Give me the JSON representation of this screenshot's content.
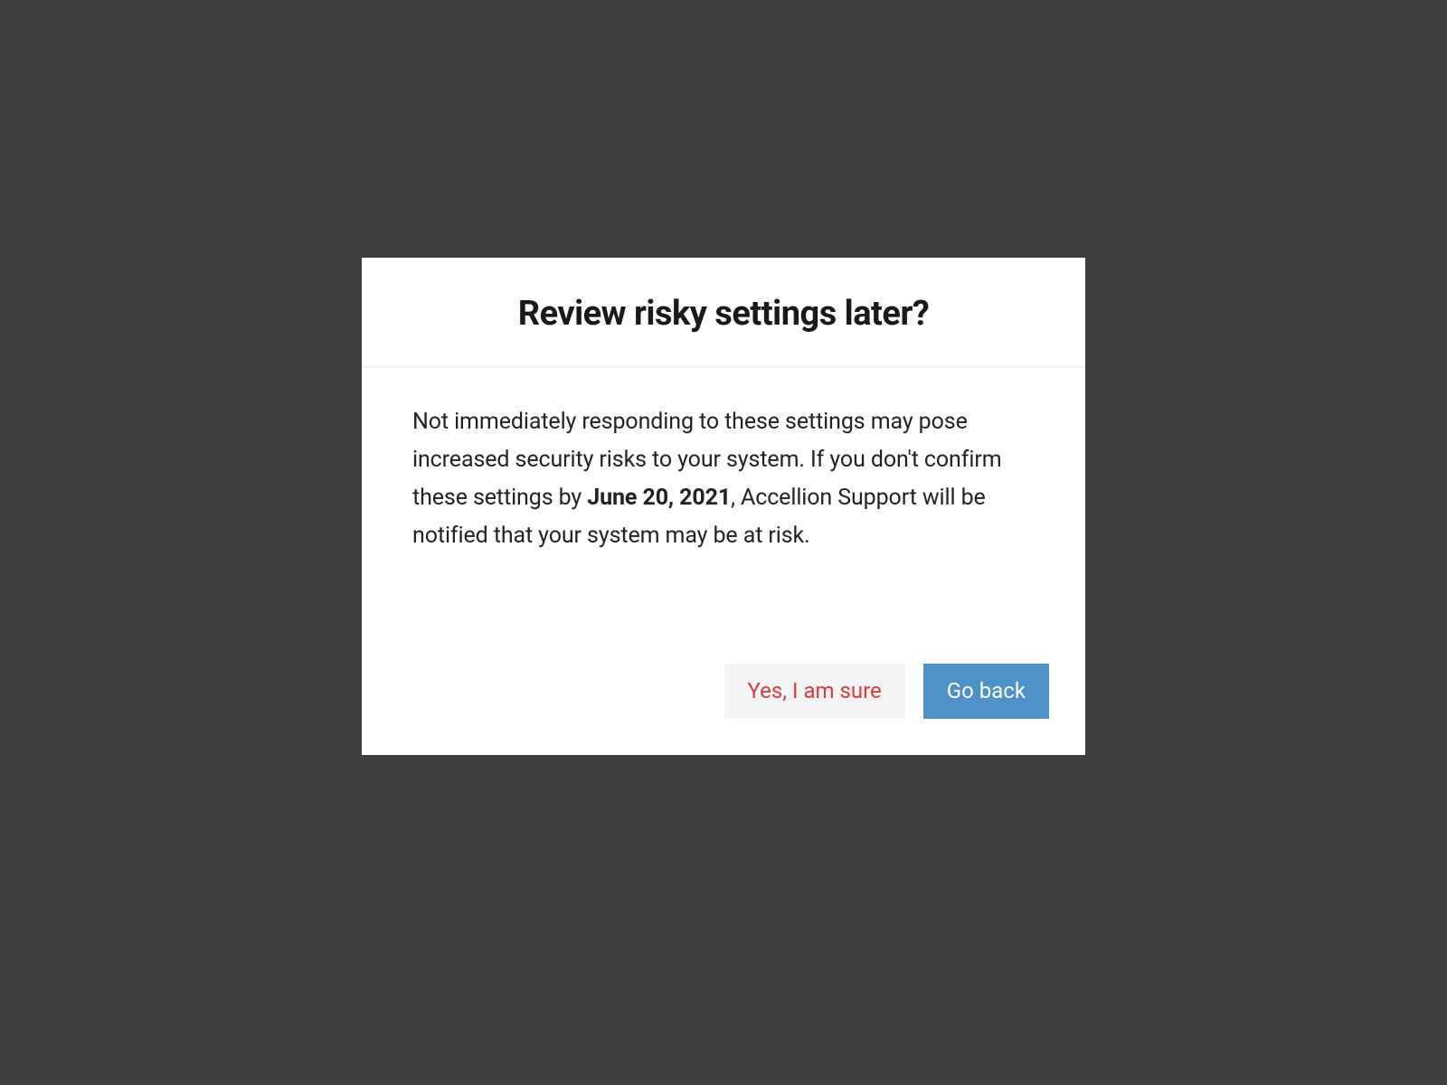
{
  "dialog": {
    "title": "Review risky settings later?",
    "message_part1": "Not immediately responding to these settings may pose increased security risks to your system. If you don't confirm these settings by ",
    "message_deadline": "June 20, 2021",
    "message_part2": ", Accellion Support will be notified that your system may be at risk.",
    "confirm_label": "Yes, I am sure",
    "cancel_label": "Go back"
  }
}
